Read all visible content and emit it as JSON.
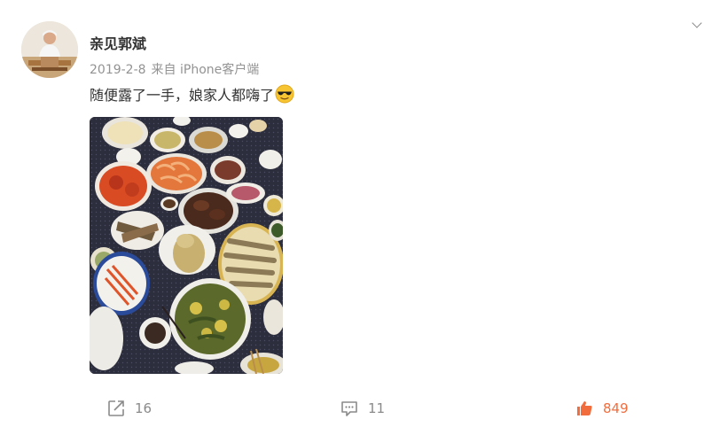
{
  "post": {
    "username": "亲见郭斌",
    "date": "2019-2-8",
    "source": "来自 iPhone客户端",
    "text": "随便露了一手，娘家人都嗨了",
    "emoji_icon": "cool-sunglasses-emoji",
    "image_alt": "一桌年夜饭菜肴"
  },
  "actions": {
    "repost_count": "16",
    "comment_count": "11",
    "like_count": "849"
  },
  "icons": {
    "more": "chevron-down-icon",
    "repost": "share-icon",
    "comment": "comment-icon",
    "like": "thumbs-up-icon"
  },
  "colors": {
    "text": "#333333",
    "meta": "#939393",
    "action": "#8a8a8a",
    "like_accent": "#f26d3d"
  }
}
